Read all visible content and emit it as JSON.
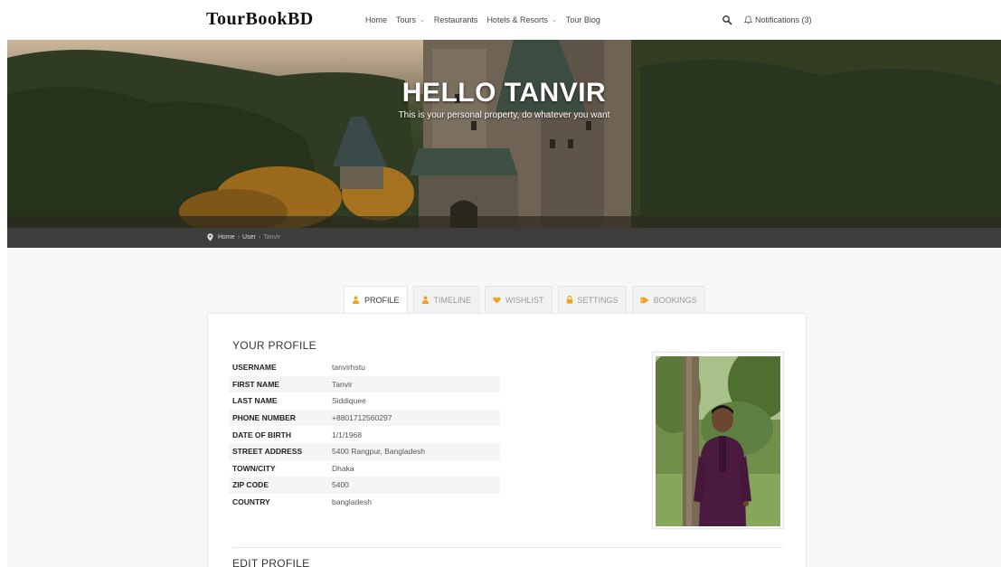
{
  "brand": {
    "logo": "TourBookBD"
  },
  "nav": {
    "items": [
      {
        "label": "Home",
        "dropdown": false
      },
      {
        "label": "Tours",
        "dropdown": true
      },
      {
        "label": "Restaurants",
        "dropdown": false
      },
      {
        "label": "Hotels & Resorts",
        "dropdown": true
      },
      {
        "label": "Tour Blog",
        "dropdown": false
      }
    ],
    "notifications_label": "Notifications (3)",
    "search_icon": "search-icon",
    "bell_icon": "bell-icon"
  },
  "hero": {
    "title": "HELLO TANVIR",
    "subtitle": "This is your personal property, do whatever you want"
  },
  "breadcrumb": {
    "items": [
      "Home",
      "User",
      "Tanvir"
    ],
    "icon": "location-pin-icon"
  },
  "tabs": [
    {
      "label": "PROFILE",
      "icon": "user-icon",
      "active": true
    },
    {
      "label": "TIMELINE",
      "icon": "user-icon",
      "active": false
    },
    {
      "label": "WISHLIST",
      "icon": "heart-icon",
      "active": false
    },
    {
      "label": "SETTINGS",
      "icon": "lock-icon",
      "active": false
    },
    {
      "label": "BOOKINGS",
      "icon": "tag-icon",
      "active": false
    }
  ],
  "profile": {
    "section_title": "YOUR PROFILE",
    "fields": [
      {
        "label": "USERNAME",
        "value": "tanvirhstu"
      },
      {
        "label": "FIRST NAME",
        "value": "Tanvir"
      },
      {
        "label": "LAST NAME",
        "value": "Siddiquee"
      },
      {
        "label": "PHONE NUMBER",
        "value": "+8801712560297"
      },
      {
        "label": "DATE OF BIRTH",
        "value": "1/1/1968"
      },
      {
        "label": "STREET ADDRESS",
        "value": "5400 Rangpur, Bangladesh"
      },
      {
        "label": "TOWN/CITY",
        "value": "Dhaka"
      },
      {
        "label": "ZIP CODE",
        "value": "5400"
      },
      {
        "label": "COUNTRY",
        "value": "bangladesh"
      }
    ]
  },
  "edit_section_title": "EDIT PROFILE",
  "colors": {
    "accent": "#f0a31c",
    "breadcrumb_bg": "#3d3d3d",
    "page_bg": "#f7f7f7"
  }
}
